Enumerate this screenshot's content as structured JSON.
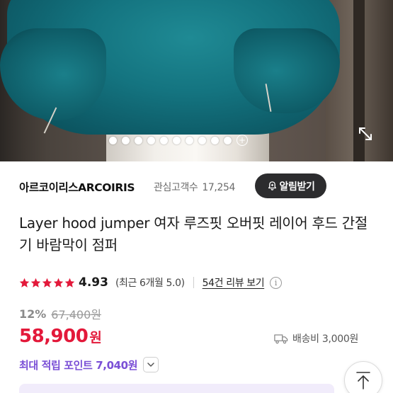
{
  "gallery": {
    "dot_count": 11,
    "active_index": 0,
    "more_icon": "plus-circle-icon",
    "expand_icon": "expand-arrows-icon"
  },
  "store": {
    "name": "아르코이리스ARCOIRIS",
    "followers_label": "관심고객수",
    "followers_count": "17,254",
    "alarm_button": "알림받기"
  },
  "product": {
    "title": "Layer hood jumper 여자 루즈핏 오버핏 레이어 후드 간절기 바람막이 점퍼"
  },
  "rating": {
    "stars": 5,
    "score": "4.93",
    "recent": "(최근 6개월 5.0)",
    "reviews_link": "54건 리뷰 보기",
    "info_icon": "info-icon"
  },
  "price": {
    "discount": "12%",
    "original": "67,400원",
    "sale": "58,900",
    "currency": "원",
    "shipping": "배송비 3,000원",
    "points": "최대 적립 포인트 7,040원"
  },
  "colors": {
    "sale_red": "#e3193a",
    "points_purple": "#7a4fd6",
    "star_red": "#e3193a",
    "button_dark": "#2c2c2e"
  }
}
